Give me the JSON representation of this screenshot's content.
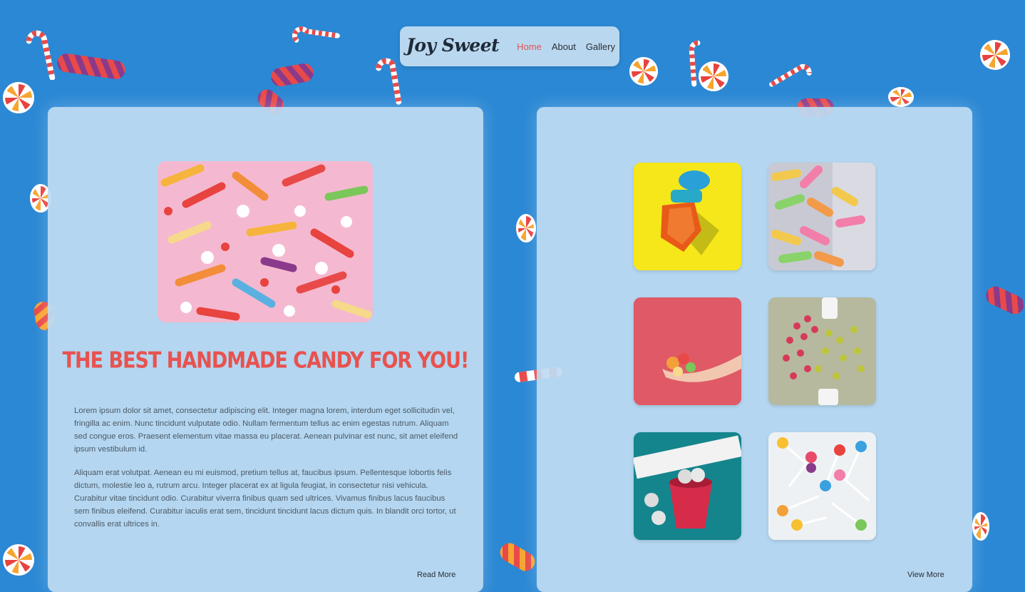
{
  "brand": {
    "logo_text": "Joy Sweet"
  },
  "nav": {
    "items": [
      {
        "label": "Home",
        "active": true
      },
      {
        "label": "About",
        "active": false
      },
      {
        "label": "Gallery",
        "active": false
      }
    ]
  },
  "about": {
    "heading": "The Best Handmade Candy For You!",
    "paragraphs": [
      "Lorem ipsum dolor sit amet, consectetur adipiscing elit. Integer magna lorem, interdum eget sollicitudin vel, fringilla ac enim. Nunc tincidunt vulputate odio. Nullam fermentum tellus ac enim egestas rutrum. Aliquam sed congue eros. Praesent elementum vitae massa eu placerat. Aenean pulvinar est nunc, sit amet eleifend ipsum vestibulum id.",
      "Aliquam erat volutpat. Aenean eu mi euismod, pretium tellus at, faucibus ipsum. Pellentesque lobortis felis dictum, molestie leo a, rutrum arcu. Integer placerat ex at ligula feugiat, in consectetur nisi vehicula. Curabitur vitae tincidunt odio. Curabitur viverra finibus quam sed ultrices. Vivamus finibus lacus faucibus sem finibus eleifend. Curabitur iaculis erat sem, tincidunt tincidunt lacus dictum quis. In blandit orci tortor, ut convallis erat ultrices in."
    ],
    "read_more": "Read More"
  },
  "gallery": {
    "images": [
      {
        "subject": "ring-pop-candy"
      },
      {
        "subject": "sour-gummies"
      },
      {
        "subject": "hand-holding-jellies"
      },
      {
        "subject": "spilled-gumdrops"
      },
      {
        "subject": "love-hearts-bucket"
      },
      {
        "subject": "lollipops"
      }
    ],
    "view_more": "View More"
  },
  "colors": {
    "background": "#2b88d4",
    "accent": "#e8524f",
    "panel": "#bedcf2"
  }
}
